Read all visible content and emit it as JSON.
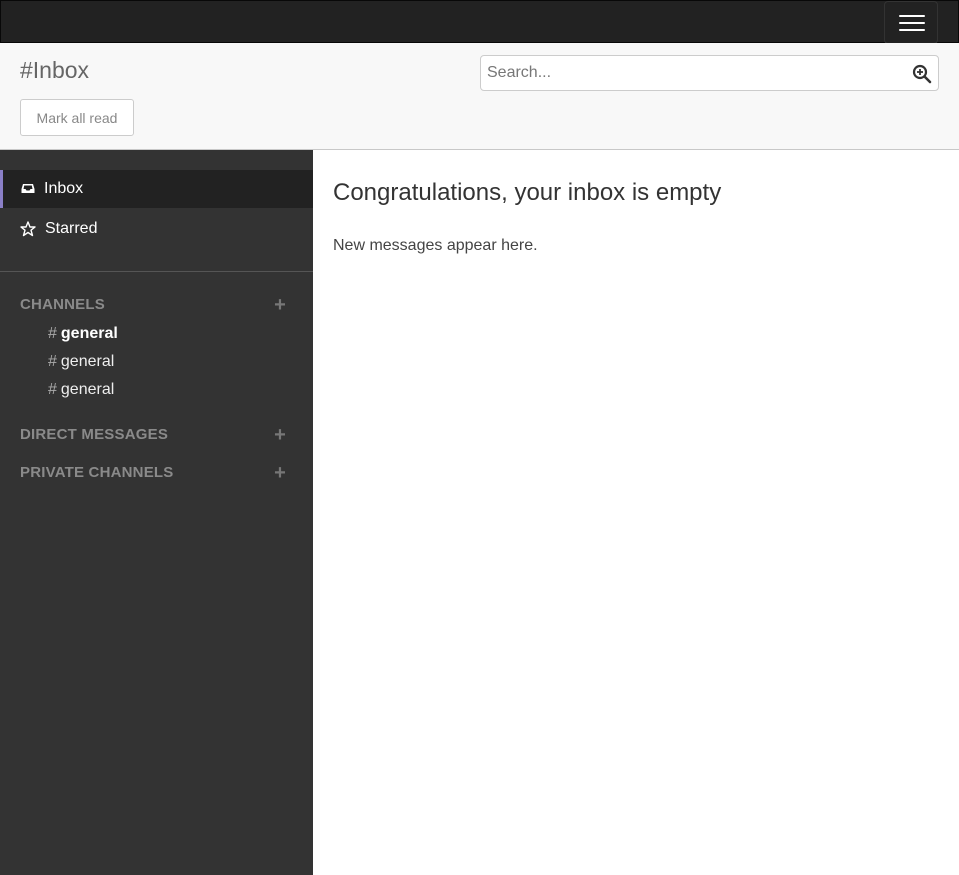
{
  "navbar": {
    "toggle_icon": "hamburger-menu-icon"
  },
  "header": {
    "title": "#Inbox",
    "mark_all_read_label": "Mark all read",
    "search": {
      "placeholder": "Search...",
      "value": "",
      "icon": "search-icon"
    }
  },
  "sidebar": {
    "nav": [
      {
        "label": "Inbox",
        "icon": "inbox-icon",
        "active": true
      },
      {
        "label": "Starred",
        "icon": "star-icon",
        "active": false
      }
    ],
    "sections": {
      "channels": {
        "title": "CHANNELS",
        "add_icon": "plus-icon"
      },
      "direct_messages": {
        "title": "DIRECT MESSAGES",
        "add_icon": "plus-icon"
      },
      "private_channels": {
        "title": "PRIVATE CHANNELS",
        "add_icon": "plus-icon"
      }
    },
    "channels": [
      {
        "hash": "#",
        "name": "general",
        "unread": true
      },
      {
        "hash": "#",
        "name": "general",
        "unread": false
      },
      {
        "hash": "#",
        "name": "general",
        "unread": false
      }
    ]
  },
  "main": {
    "heading": "Congratulations, your inbox is empty",
    "message": "New messages appear here."
  },
  "colors": {
    "navbar": "#222222",
    "sidebar": "#333333",
    "active_accent": "#8a7fc7"
  }
}
